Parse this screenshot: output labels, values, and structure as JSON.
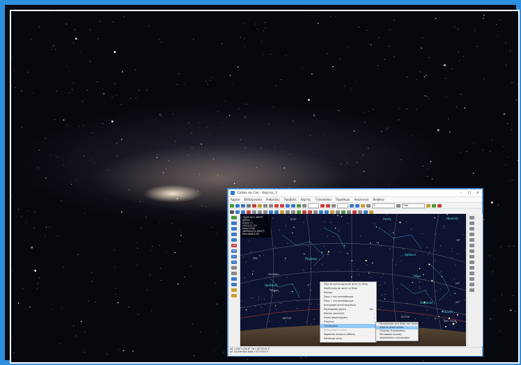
{
  "window": {
    "title": "Cartes du Ciel - Χάρτης_1",
    "minimize": "–",
    "maximize": "□",
    "close": "✕"
  },
  "menu": [
    "Αρχείο",
    "Επεξεργασία",
    "Ρυθμίσεις",
    "Προβολή",
    "Χάρτης",
    "Τηλεσκόπιο",
    "Παράθυρο",
    "Αναλυτικά",
    "Βοήθεια"
  ],
  "toolbar": {
    "fov_value": "3'",
    "object_combo": "Όψη"
  },
  "left_tools": [
    "AZ",
    "EQ",
    "Ec",
    "Gl"
  ],
  "info": {
    "lines": [
      "Ύψ/Αζ πυτ: 465ΤΡ",
      "Αθήνα",
      "Ζώνη:+2",
      "19/12/21-22:",
      "Ισημ(1950)",
      "18h58m11s (EEST)",
      "Μεσ.ΑΜΦ:0 ΑΛ",
      "ΑΛ 0:5:6.3 7",
      "ΤΧΑΑ:+1°55'00\""
    ]
  },
  "chart_labels": {
    "pegasus": "Πήγασος",
    "aquila": "Αετός",
    "hercules": "Ηρακλής",
    "dragon": "Δράκων",
    "eridanus": "Ηριδανός",
    "vela": "Ύδρα",
    "lepus": "Λαγωός",
    "centaurus": "Κένταυρος",
    "pisces": "Ιχθύες",
    "taurus": "Ταύρος",
    "ursa_major": "Μεγάλη Άρκτος",
    "cancer": "Καρκίνος",
    "scorpius": "Σκορπιός",
    "sirius": "Σείριος",
    "fornax": "Κάμινος",
    "ngc": "NGC 2516",
    "m_label": "M 67",
    "saturn": "Κρόνος",
    "moon": "Σελήνη",
    "sun": "Ήλιος",
    "jupiter": "Ζευς",
    "pleiades": "Πλειάδες",
    "east_top": "Ανατολή",
    "ra_20": "20h",
    "dec_30": "30°",
    "ticks": [
      "-20°",
      "-40°",
      "-60°",
      "-80°",
      "180°00'",
      "160°00'",
      "140°00'",
      "120°00'",
      "100°00'"
    ]
  },
  "context_menu": {
    "items": [
      {
        "label": "Όλα τα αντικείμενα σε αυτή τη θέση",
        "kbd": "",
        "arrow": false,
        "state": "normal"
      },
      {
        "label": "Αναζήτηση σε αυτή τη θέση",
        "kbd": "",
        "arrow": false,
        "state": "normal"
      },
      {
        "label": "Κέντρο",
        "kbd": "",
        "arrow": false,
        "state": "normal"
      },
      {
        "label": "Ζουμ + και κεντράρισμα",
        "kbd": "",
        "arrow": false,
        "state": "normal"
      },
      {
        "label": "Ζουμ − και κεντράρισμα",
        "kbd": "",
        "arrow": false,
        "state": "normal"
      },
      {
        "label": "Αντιγραφή συντεταγμένων",
        "kbd": "",
        "arrow": false,
        "state": "normal"
      },
      {
        "label": "Επισήμανση χάρτη",
        "kbd": "Del",
        "arrow": false,
        "state": "normal"
      },
      {
        "label": "Κύκλος ερευνητή",
        "kbd": "",
        "arrow": true,
        "state": "normal"
      },
      {
        "label": "Λίστα παρατήρησης",
        "kbd": "",
        "arrow": true,
        "state": "normal"
      },
      {
        "label": "Ετικέτες",
        "kbd": "",
        "arrow": true,
        "state": "normal"
      },
      {
        "label": "Τηλεσκόπιο",
        "kbd": "",
        "arrow": true,
        "state": "selected"
      },
      {
        "label": "Καταγραφή εικόνας",
        "kbd": "",
        "arrow": false,
        "state": "disabled"
      },
      {
        "label": "Εμφάνιση πλήρους οθόνης",
        "kbd": "",
        "arrow": false,
        "state": "normal"
      },
      {
        "label": "Κλείδωμα στην",
        "kbd": "",
        "arrow": false,
        "state": "normal"
      }
    ]
  },
  "sub_menu": {
    "items": [
      {
        "label": "Μετακίνηση στη θέση του δείκτη",
        "state": "normal"
      },
      {
        "label": "Slew to chart center",
        "state": "selected"
      },
      {
        "label": "Σύνδεση Τηλεσκοπίου",
        "state": "normal"
      },
      {
        "label": "Μεταφορά κίνησης",
        "state": "normal"
      },
      {
        "label": "Αποσύνδεση τηλεσκοπίου",
        "state": "normal"
      }
    ]
  },
  "status": {
    "line1": "AZ +144°13'26.8\" Ύψ:+42°10'15.7\"",
    "line2": "ΑΛ 11h49m40s Απόκ.+23°19'20.1\""
  },
  "colors": {
    "frame_blue": "#2f8fdf",
    "chart_bg": "#0d1330",
    "constellation_label": "#4fe3e3",
    "star_label": "#e8d84a",
    "menu_highlight": "#91c9f7"
  }
}
